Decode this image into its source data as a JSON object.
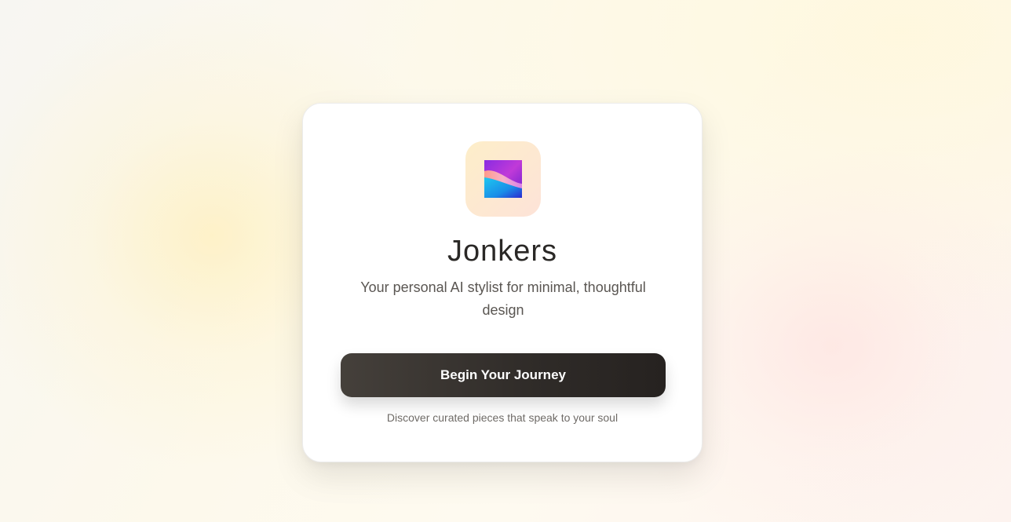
{
  "app": {
    "name": "Jonkers",
    "tagline": "Your personal AI stylist for minimal, thoughtful design"
  },
  "logo": {
    "icon": "gradient-wave-logo"
  },
  "cta": {
    "label": "Begin Your Journey"
  },
  "footer": {
    "text": "Discover curated pieces that speak to your soul"
  },
  "colors": {
    "button": "#2f2b28",
    "title": "#2a2826",
    "logo_tile": "#fde8d0"
  }
}
